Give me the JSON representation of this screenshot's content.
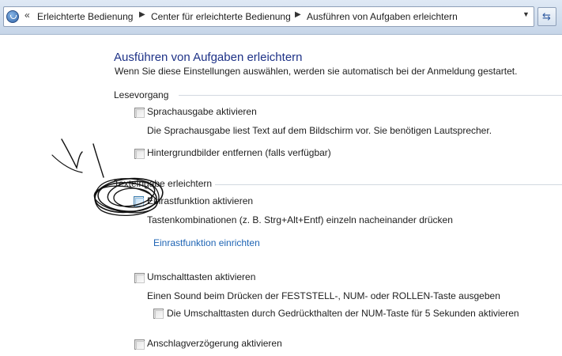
{
  "address_bar": {
    "crumbs": [
      "Erleichterte Bedienung",
      "Center für erleichterte Bedienung",
      "Ausführen von Aufgaben erleichtern"
    ],
    "overflow_icon": "double-chevron-left-icon",
    "separator_icon": "chevron-right-icon",
    "dropdown_icon": "chevron-down-icon",
    "refresh_icon": "refresh-icon"
  },
  "page": {
    "title": "Ausführen von Aufgaben erleichtern",
    "subtitle": "Wenn Sie diese Einstellungen auswählen, werden sie automatisch bei der Anmeldung gestartet.",
    "title_color": "#1e3287",
    "link_color": "#1e64b4"
  },
  "sections": {
    "lesevorgang": {
      "heading": "Lesevorgang",
      "speech": {
        "label": "Sprachausgabe aktivieren",
        "checked": false,
        "description": "Die Sprachausgabe liest Text auf dem Bildschirm vor. Sie benötigen Lautsprecher."
      },
      "background": {
        "label": "Hintergrundbilder entfernen (falls verfügbar)",
        "checked": false
      }
    },
    "texteingabe": {
      "heading": "Texteingabe erleichtern",
      "sticky": {
        "label": "Einrastfunktion aktivieren",
        "checked": false,
        "description": "Tastenkombinationen (z. B. Strg+Alt+Entf) einzeln nacheinander drücken",
        "link": "Einrastfunktion einrichten"
      },
      "toggle": {
        "label": "Umschalttasten aktivieren",
        "checked": false,
        "description": "Einen Sound beim Drücken der FESTSTELL-, NUM- oder ROLLEN-Taste ausgeben",
        "sub_label": "Die Umschalttasten durch Gedrückthalten der NUM-Taste für 5 Sekunden aktivieren",
        "sub_checked": false
      },
      "filter": {
        "label": "Anschlagverzögerung aktivieren",
        "checked": false
      }
    }
  }
}
